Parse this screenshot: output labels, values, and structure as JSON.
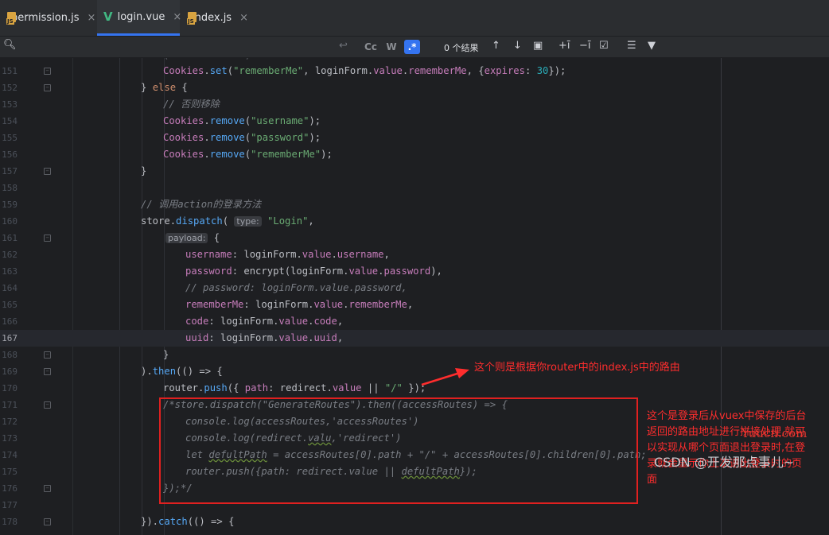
{
  "tabs": [
    {
      "name": "permission.js",
      "icon": "js-file-icon",
      "active": false
    },
    {
      "name": "login.vue",
      "icon": "vue-file-icon",
      "active": true
    },
    {
      "name": "index.js",
      "icon": "js-file-icon",
      "active": false
    }
  ],
  "tab_close": "×",
  "js_label": "JS",
  "search": {
    "match_case": "Cc",
    "words": "W",
    "regex": ".*",
    "results": "0 个结果"
  },
  "lines": [
    {
      "n": "151",
      "fold": true
    },
    {
      "n": "152",
      "fold": true
    },
    {
      "n": "153"
    },
    {
      "n": "154"
    },
    {
      "n": "155"
    },
    {
      "n": "156"
    },
    {
      "n": "157",
      "fold": true
    },
    {
      "n": "158"
    },
    {
      "n": "159"
    },
    {
      "n": "160"
    },
    {
      "n": "161",
      "fold": true
    },
    {
      "n": "162"
    },
    {
      "n": "163"
    },
    {
      "n": "164"
    },
    {
      "n": "165"
    },
    {
      "n": "166"
    },
    {
      "n": "167"
    },
    {
      "n": "168",
      "fold": true
    },
    {
      "n": "169",
      "fold": true
    },
    {
      "n": "170"
    },
    {
      "n": "171",
      "fold": true
    },
    {
      "n": "172"
    },
    {
      "n": "173"
    },
    {
      "n": "174"
    },
    {
      "n": "175"
    },
    {
      "n": "176",
      "fold": true
    },
    {
      "n": "177"
    },
    {
      "n": "178",
      "fold": true
    }
  ],
  "code": {
    "l150": "(             )",
    "l151_a": "Cookies",
    "l151_b": ".",
    "l151_c": "set",
    "l151_d": "(",
    "l151_e": "\"rememberMe\"",
    "l151_f": ", loginForm.",
    "l151_g": "value",
    "l151_h": ".",
    "l151_i": "rememberMe",
    "l151_j": ", {",
    "l151_k": "expires",
    "l151_l": ": ",
    "l151_m": "30",
    "l151_n": "});",
    "l152_a": "} ",
    "l152_b": "else",
    "l152_c": " {",
    "l153": "// 否则移除",
    "l154_s": "\"username\"",
    "l155_s": "\"password\"",
    "l156_s": "\"rememberMe\"",
    "cookies": "Cookies",
    "remove": "remove",
    "l157": "}",
    "l159": "// 调用action的登录方法",
    "l160_a": "store",
    "l160_b": "dispatch",
    "l160_hint": "type:",
    "l160_s": "\"Login\"",
    "l161_hint": "payload:",
    "l161_b": " {",
    "l162_p": "username",
    "l162_r": ": loginForm.",
    "l162_v": "value",
    "l162_x": "username",
    "l163_p": "password",
    "l163_r": ": encrypt(loginForm.",
    "l163_x": "password",
    "l164": "// password: loginForm.value.password,",
    "l165_p": "rememberMe",
    "l165_r": ": loginForm.",
    "l165_x": "rememberMe",
    "l166_p": "code",
    "l166_x": "code",
    "l167_p": "uuid",
    "l167_x": "uuid",
    "l168": "}",
    "l169_a": ").",
    "l169_b": "then",
    "l169_c": "(() => {",
    "l170_a": "router",
    "l170_b": "push",
    "l170_c": "({ ",
    "l170_d": "path",
    "l170_e": ": redirect.",
    "l170_f": "value",
    "l170_g": " || ",
    "l170_h": "\"/\"",
    "l170_i": " });",
    "l171": "/*store.dispatch(\"GenerateRoutes\").then((accessRoutes) => {",
    "l172": "console.log(accessRoutes,'accessRoutes')",
    "l173_a": "console.log(redirect.",
    "l173_b": "valu",
    "l173_c": ",'redirect')",
    "l174_a": "let ",
    "l174_b": "defultPath",
    "l174_c": " = accessRoutes[0].path + \"/\" + accessRoutes[0].children[0].path;",
    "l175_a": "router.push({path: redirect.value || ",
    "l175_b": "defultPath",
    "l175_c": "});",
    "l176": "});*/",
    "l178_a": "}).",
    "l178_b": "catch",
    "l178_c": "(() => {"
  },
  "annotations": {
    "arrow_note": "这个则是根据你router中的index.js中的路由",
    "box_note": "这个是登录后从vuex中保存的后台返回的路由地址进行拼接处理,就可以实现从哪个页面退出登录时,在登录就会显示你上次退出登录时的页面"
  },
  "watermarks": {
    "site": "Yuucn.com",
    "csdn": "CSDN @开发那点事儿~"
  },
  "colors": {
    "annotation_red": "#ff2d2d",
    "active_tab_accent": "#3574f0"
  }
}
